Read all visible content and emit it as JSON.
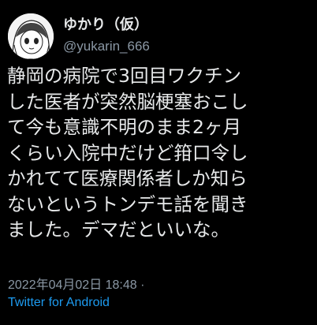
{
  "author": {
    "display_name": "ゆかり（仮）",
    "handle": "@yukarin_666"
  },
  "tweet": {
    "lines": [
      "静岡の病院で3回目ワクチン",
      "した医者が突然脳梗塞おこし",
      "て今も意識不明のまま2ヶ月",
      "くらい入院中だけど箝口令し",
      "かれてて医療関係者しか知ら",
      "ないというトンデモ話を聞き",
      "ました。デマだといいな。"
    ],
    "timestamp": "2022年04月02日 18:48 ·",
    "source": "Twitter for Android"
  },
  "colors": {
    "background": "#000000",
    "text": "#e7e9ea",
    "secondary": "#8b98a5",
    "link": "#1d9bf0"
  }
}
